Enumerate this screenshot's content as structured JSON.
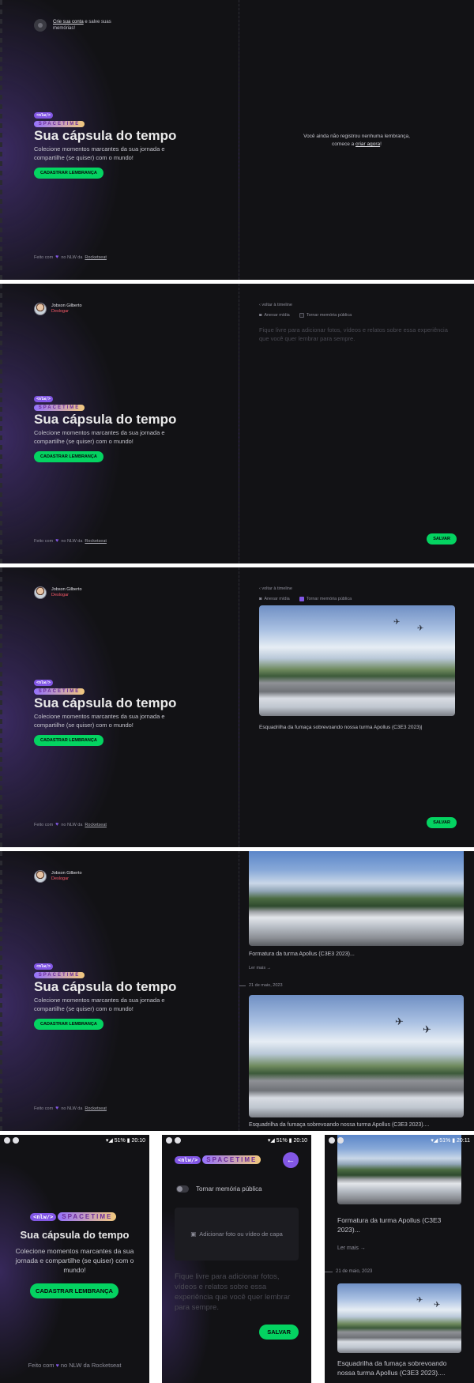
{
  "brand": {
    "nlw": "<nlw/>",
    "spacetime": "SPACETIME"
  },
  "hero": {
    "title": "Sua cápsula do tempo",
    "description": "Colecione momentos marcantes da sua jornada e compartilhe (se quiser) com o mundo!",
    "cta": "CADASTRAR LEMBRANÇA"
  },
  "footer": {
    "prefix": "Feito com",
    "middle": "no NLW da",
    "link": "Rocketseat"
  },
  "signin": {
    "link": "Crie sua conta",
    "rest": "e salve suas memórias!"
  },
  "user": {
    "name": "Jobson Gilberto",
    "logout": "Deslogar"
  },
  "empty_state": {
    "line1": "Você ainda não registrou nenhuma lembrança,",
    "line2": "comece a",
    "link": "criar agora",
    "end": "!"
  },
  "editor": {
    "back": "voltar à timeline",
    "attach": "Anexar mídia",
    "public": "Tornar memória pública",
    "placeholder": "Fique livre para adicionar fotos, vídeos e relatos sobre essa experiência que você quer lembrar para sempre.",
    "save": "SALVAR",
    "caption": "Esquadrilha da fumaça sobrevoando nossa turma Apollus (C3E3 2023)|"
  },
  "timeline": {
    "memory1_caption": "Formatura da turma Apollus (C3E3 2023)...",
    "read_more": "Ler mais",
    "date": "21 de maio, 2023",
    "memory2_caption": "Esquadrilha da fumaça sobrevoando nossa turma Apollus (C3E3 2023)...."
  },
  "mobile": {
    "status_time_1": "20:10",
    "status_time_2": "20:10",
    "status_time_3": "20:11",
    "battery": "51%",
    "copy": "Feito com",
    "copy_end": "no NLW da Rocketseat",
    "public_toggle": "Tornar memória pública",
    "add_media": "Adicionar foto ou vídeo de capa",
    "placeholder": "Fique livre para adicionar fotos, vídeos e relatos sobre essa experiência que você quer lembrar para sempre.",
    "save": "SALVAR",
    "memory1_caption": "Formatura da turma Apollus (C3E3 2023)...",
    "read_more": "Ler mais",
    "date": "21 de maio, 2023",
    "memory2_caption": "Esquadrilha da fumaça sobrevoando nossa turma Apollus (C3E3 2023)...."
  },
  "colors": {
    "accent": "#8257e5",
    "green": "#04d361",
    "background": "#121215",
    "logout": "#f75a68"
  }
}
